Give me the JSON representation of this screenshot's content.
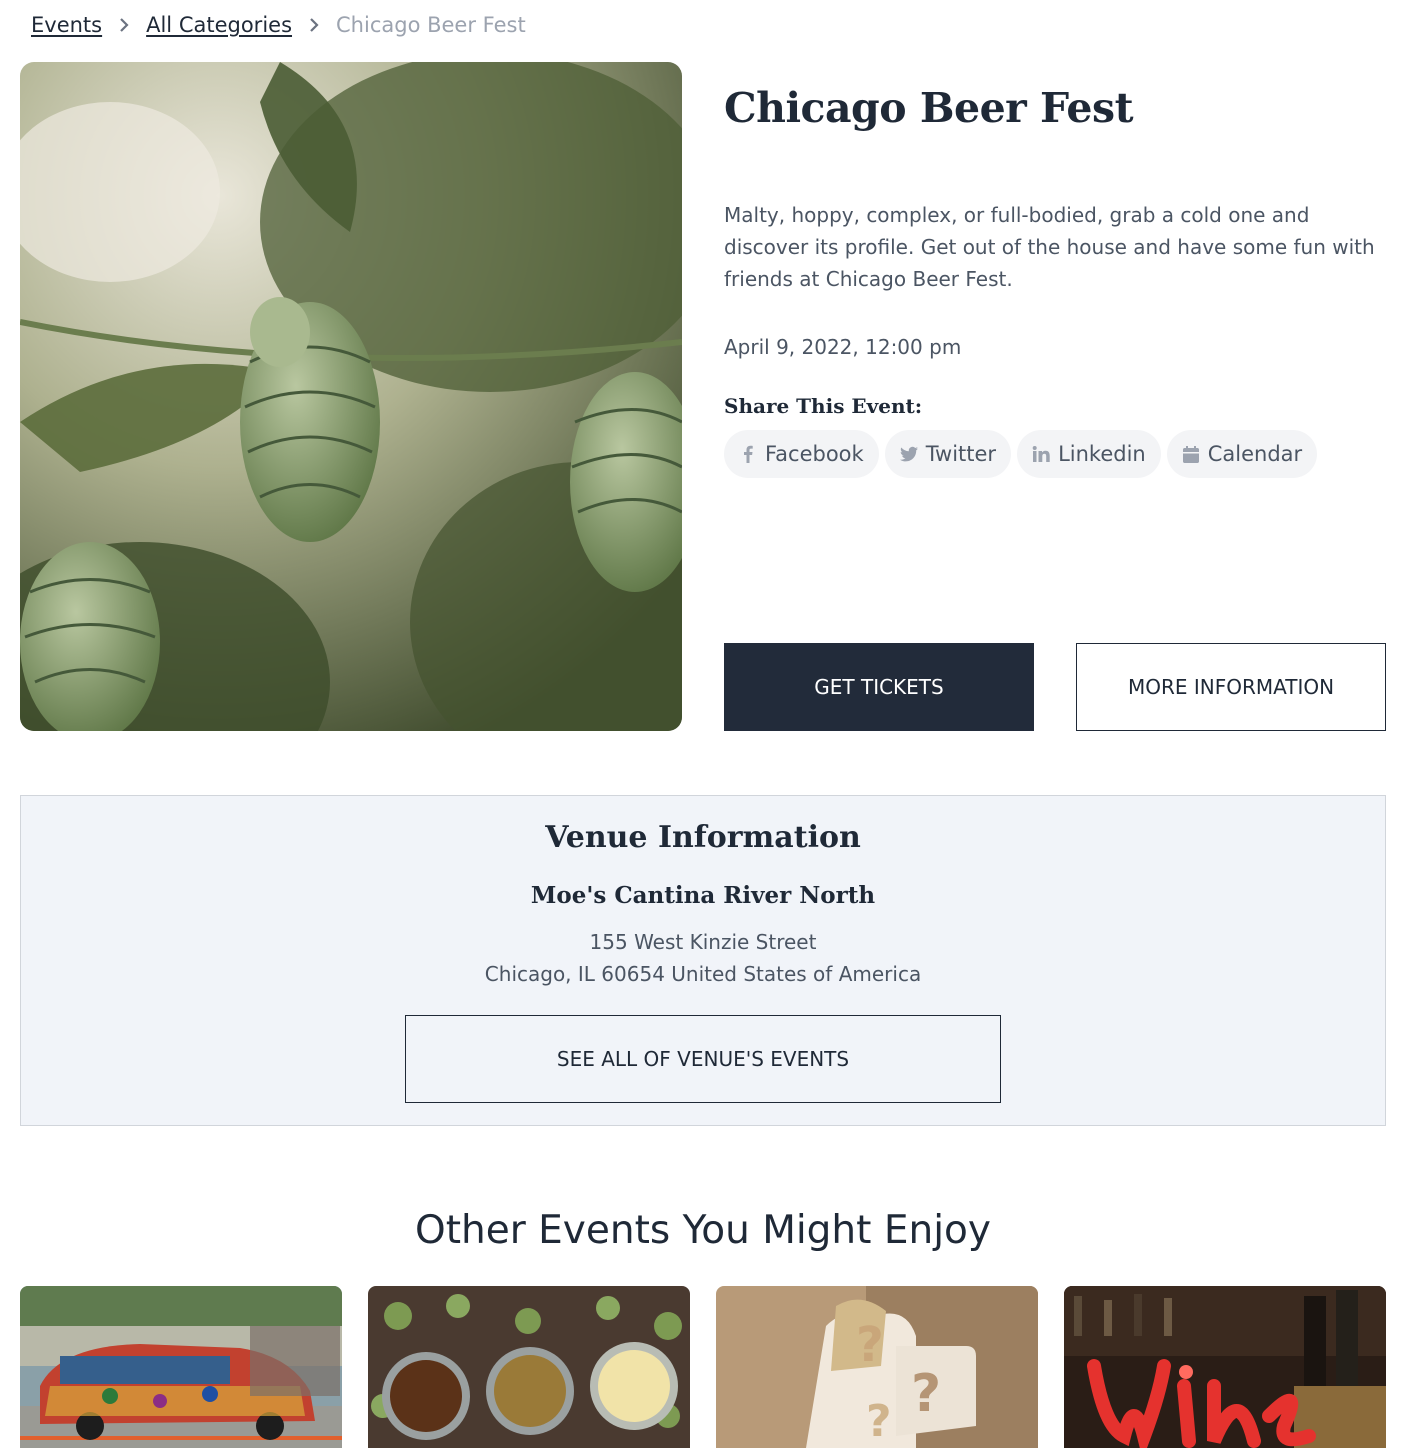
{
  "breadcrumb": {
    "items": [
      "Events",
      "All Categories"
    ],
    "current": "Chicago Beer Fest"
  },
  "event": {
    "title": "Chicago Beer Fest",
    "description": "Malty, hoppy, complex, or full-bodied, grab a cold one and discover its profile. Get out of the house and have some fun with friends at Chicago Beer Fest.",
    "datetime": "April 9, 2022, 12:00 pm",
    "image_icon": "hops-photo"
  },
  "share": {
    "title": "Share This Event:",
    "buttons": [
      {
        "label": "Facebook",
        "icon": "facebook-icon"
      },
      {
        "label": "Twitter",
        "icon": "twitter-icon"
      },
      {
        "label": "Linkedin",
        "icon": "linkedin-icon"
      },
      {
        "label": "Calendar",
        "icon": "calendar-icon"
      }
    ]
  },
  "actions": {
    "get_tickets": "GET TICKETS",
    "more_info": "MORE INFORMATION"
  },
  "venue": {
    "heading": "Venue Information",
    "name": "Moe's Cantina River North",
    "address_line1": "155 West Kinzie Street",
    "address_line2": "Chicago, IL 60654 United States of America",
    "see_all": "SEE ALL OF VENUE'S EVENTS"
  },
  "other_events": {
    "heading": "Other Events You Might Enjoy",
    "cards": [
      {
        "image": "art-car-parade-photo"
      },
      {
        "image": "beer-flight-hops-photo"
      },
      {
        "image": "question-marks-photo"
      },
      {
        "image": "wine-neon-sign-photo"
      }
    ]
  },
  "colors": {
    "primary": "#222b3a",
    "venue_bg": "#f1f4f9",
    "chip_bg": "#f3f4f6"
  }
}
